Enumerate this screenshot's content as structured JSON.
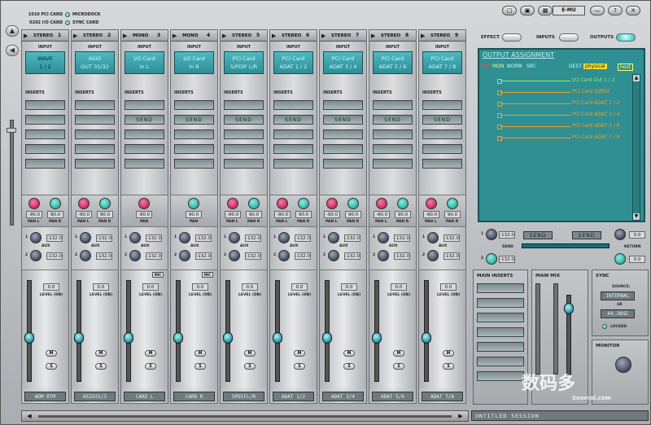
{
  "hardware": {
    "rows": [
      {
        "left": "1010 PCI CARD",
        "right": "MICRODOCK"
      },
      {
        "left": "0202 I/O CARD",
        "right": "SYNC CARD"
      }
    ]
  },
  "strips": [
    {
      "type": "STEREO",
      "num": "1",
      "input_line1": "WAVE",
      "input_line2": "1 / 2",
      "dark": false,
      "send": [
        "",
        ""
      ],
      "pan": [
        "-90.0",
        "90.0"
      ],
      "pan_labels": [
        "PAN L",
        "PAN R"
      ],
      "aux": [
        "-132.0",
        "-132.0"
      ],
      "level": "0.0",
      "mic": false,
      "name": "WDM RTM",
      "fader": 0.42
    },
    {
      "type": "STEREO",
      "num": "2",
      "input_line1": "ASIO",
      "input_line2": "OUT 31/32",
      "dark": true,
      "send": [
        "",
        ""
      ],
      "pan": [
        "-90.0",
        "90.0"
      ],
      "pan_labels": [
        "PAN L",
        "PAN R"
      ],
      "aux": [
        "-132.0",
        "-132.0"
      ],
      "level": "0.0",
      "mic": false,
      "name": "ASIO31/3",
      "fader": 0.42
    },
    {
      "type": "MONO",
      "num": "3",
      "input_line1": "I/O Card",
      "input_line2": "In L",
      "dark": true,
      "send": [
        "SEND",
        ""
      ],
      "pan": [
        "-90.0"
      ],
      "pan_labels": [
        "PAN"
      ],
      "aux": [
        "-132.0",
        "-132.0"
      ],
      "level": "0.0",
      "mic": true,
      "name": "CARD L",
      "fader": 0.42
    },
    {
      "type": "MONO",
      "num": "4",
      "input_line1": "I/O Card",
      "input_line2": "In R",
      "dark": true,
      "send": [
        "SEND",
        ""
      ],
      "pan": [
        "90.0"
      ],
      "pan_labels": [
        "PAN"
      ],
      "aux": [
        "-132.0",
        "-132.0"
      ],
      "level": "0.0",
      "mic": true,
      "name": "CARD R",
      "fader": 0.42
    },
    {
      "type": "STEREO",
      "num": "5",
      "input_line1": "PCI Card",
      "input_line2": "S/PDIF L/R",
      "dark": true,
      "send": [
        "SEND",
        ""
      ],
      "pan": [
        "-90.0",
        "90.0"
      ],
      "pan_labels": [
        "PAN L",
        "PAN R"
      ],
      "aux": [
        "-132.0",
        "-132.0"
      ],
      "level": "0.0",
      "mic": false,
      "name": "SPDIFL/R",
      "fader": 0.42
    },
    {
      "type": "STEREO",
      "num": "6",
      "input_line1": "PCI Card",
      "input_line2": "ADAT 1 / 2",
      "dark": true,
      "send": [
        "SEND",
        ""
      ],
      "pan": [
        "-90.0",
        "90.0"
      ],
      "pan_labels": [
        "PAN L",
        "PAN R"
      ],
      "aux": [
        "-132.0",
        "-132.0"
      ],
      "level": "0.0",
      "mic": false,
      "name": "ADAT 1/2",
      "fader": 0.42
    },
    {
      "type": "STEREO",
      "num": "7",
      "input_line1": "PCI Card",
      "input_line2": "ADAT 3 / 4",
      "dark": true,
      "send": [
        "SEND",
        ""
      ],
      "pan": [
        "-90.0",
        "90.0"
      ],
      "pan_labels": [
        "PAN L",
        "PAN R"
      ],
      "aux": [
        "-132.0",
        "-132.0"
      ],
      "level": "0.0",
      "mic": false,
      "name": "ADAT 3/4",
      "fader": 0.42
    },
    {
      "type": "STEREO",
      "num": "8",
      "input_line1": "PCI Card",
      "input_line2": "ADAT 5 / 6",
      "dark": true,
      "send": [
        "SEND",
        ""
      ],
      "pan": [
        "-90.0",
        "90.0"
      ],
      "pan_labels": [
        "PAN L",
        "PAN R"
      ],
      "aux": [
        "-132.0",
        "-132.0"
      ],
      "level": "0.0",
      "mic": false,
      "name": "ADAT 5/6",
      "fader": 0.42
    },
    {
      "type": "STEREO",
      "num": "9",
      "input_line1": "PCI Card",
      "input_line2": "ADAT 7 / 8",
      "dark": true,
      "send": [
        "SEND",
        ""
      ],
      "pan": [
        "-90.0",
        "90.0"
      ],
      "pan_labels": [
        "PAN L",
        "PAN R"
      ],
      "aux": [
        "-132.0",
        "-132.0"
      ],
      "level": "0.0",
      "mic": false,
      "name": "ADAT 7/8",
      "fader": 0.42
    }
  ],
  "labels": {
    "input": "INPUT",
    "inserts": "INSERTS",
    "aux": "AUX",
    "level": "LEVEL (DB)",
    "mute": "M",
    "solo": "S",
    "mic": "MIC",
    "aux1": "1",
    "aux2": "2"
  },
  "right": {
    "emu": "E-MU",
    "tabs": {
      "effect": "EFFECT",
      "inputs": "INPUTS",
      "outputs": "OUTPUTS"
    },
    "output_assignment": "OUTPUT ASSIGNMENT",
    "oa_tabs": {
      "mix": "MIX",
      "mon": "MON",
      "norm": "NORM",
      "src": "SRC",
      "dest": "DEST",
      "physical": "physical",
      "host": "host"
    },
    "outputs": [
      "I/O Card Out 1 / 2",
      "PCI Card S/PDIF",
      "PCI Card ADAT 1 / 2",
      "PCI Card ADAT 3 / 4",
      "PCI Card ADAT 5 / 6",
      "PCI Card ADAT 7 / 8"
    ],
    "send": "SEND",
    "send_lcd": [
      "SEND",
      "SEND"
    ],
    "return": "RETURN",
    "return_val": "0.0",
    "aux_vals": [
      "-132.0",
      "-132.0"
    ],
    "main_inserts": "MAIN INSERTS",
    "main_mix": "MAIN MIX",
    "sync": "SYNC",
    "source_label": "SOURCE:",
    "source_val": "INTERNAL",
    "sr_label": "SR",
    "sr_val": "44.1KHZ",
    "locked": "LOCKED",
    "monitor": "MONITOR",
    "session": "UNTITLED SESSION"
  },
  "watermark": {
    "cn": "数码多",
    "sub": "Soomal.com"
  }
}
